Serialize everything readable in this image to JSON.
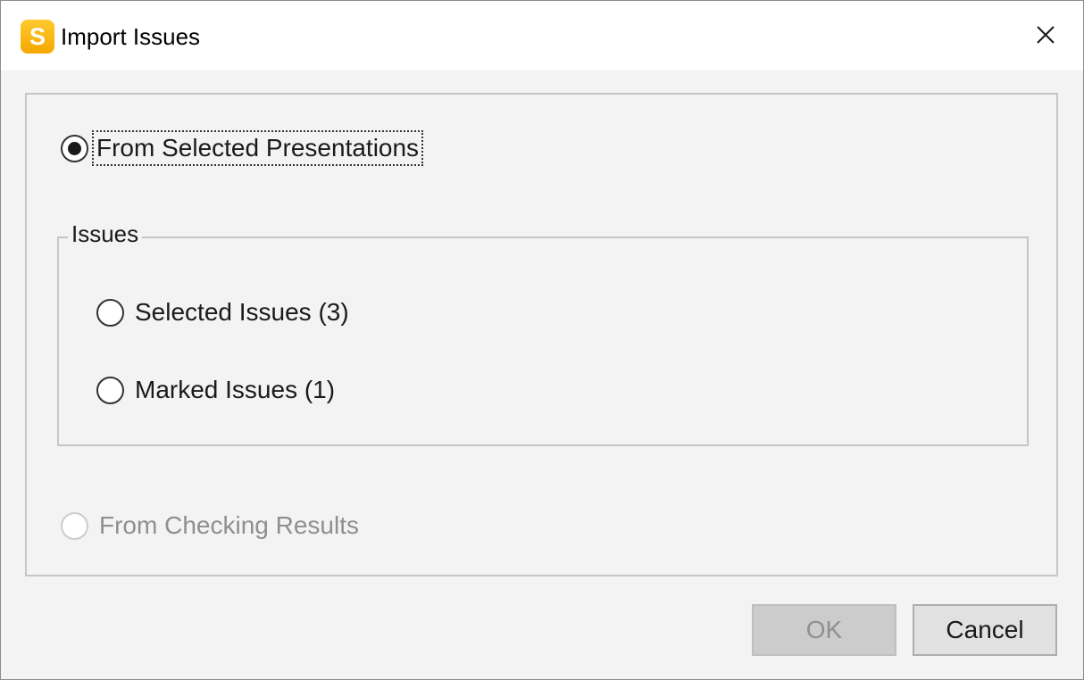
{
  "window": {
    "title": "Import Issues",
    "app_icon_letter": "S",
    "app_icon_color": "#F7B500"
  },
  "options": {
    "from_presentations": {
      "label": "From Selected Presentations",
      "checked": true,
      "enabled": true,
      "focused": true
    },
    "from_checking_results": {
      "label": "From Checking Results",
      "checked": false,
      "enabled": false
    }
  },
  "issues_group": {
    "legend": "Issues",
    "options": [
      {
        "label": "Selected Issues (3)",
        "checked": false,
        "enabled": true
      },
      {
        "label": "Marked Issues (1)",
        "checked": false,
        "enabled": true
      }
    ]
  },
  "buttons": {
    "ok_label": "OK",
    "ok_enabled": false,
    "cancel_label": "Cancel"
  },
  "icons": {
    "close": "close-icon",
    "app": "app-logo-icon"
  }
}
